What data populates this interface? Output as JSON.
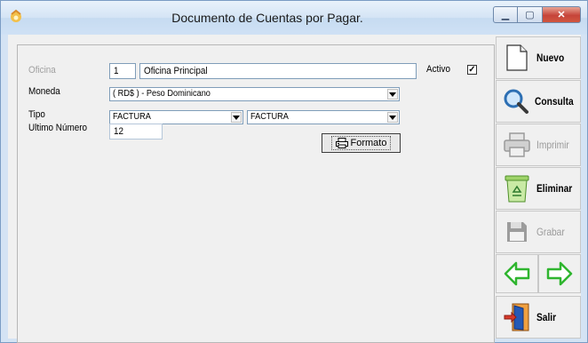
{
  "window": {
    "title": "Documento de  Cuentas por Pagar.",
    "minimize_icon": "minimize-icon",
    "maximize_icon": "maximize-icon",
    "close_icon": "close-icon"
  },
  "form": {
    "oficina": {
      "label": "Oficina",
      "code": "1",
      "name": "Oficina Principal"
    },
    "activo": {
      "label": "Activo",
      "checked": true,
      "mark": "✓"
    },
    "moneda": {
      "label": "Moneda",
      "value": "( RD$ ) - Peso Dominicano"
    },
    "tipo": {
      "label": "Tipo",
      "value1": "FACTURA",
      "value2": "FACTURA"
    },
    "ultimo_numero": {
      "label": "Ultimo Número",
      "value": "12"
    },
    "formato_button": {
      "label": "Formato",
      "icon": "printer-icon"
    }
  },
  "sidebar": {
    "nuevo": {
      "label": "Nuevo",
      "icon": "new-document-icon",
      "enabled": true
    },
    "consulta": {
      "label": "Consulta",
      "icon": "magnifier-icon",
      "enabled": true
    },
    "imprimir": {
      "label": "Imprimir",
      "icon": "printer-icon",
      "enabled": false
    },
    "eliminar": {
      "label": "Eliminar",
      "icon": "recycle-bin-icon",
      "enabled": true
    },
    "grabar": {
      "label": "Grabar",
      "icon": "floppy-disk-icon",
      "enabled": false
    },
    "prev_icon": "arrow-left-icon",
    "next_icon": "arrow-right-icon",
    "salir": {
      "label": "Salir",
      "icon": "exit-door-icon",
      "enabled": true
    }
  },
  "colors": {
    "arrow_green": "#2fb52f",
    "close_red": "#c6443a",
    "field_border": "#7f9db9"
  }
}
